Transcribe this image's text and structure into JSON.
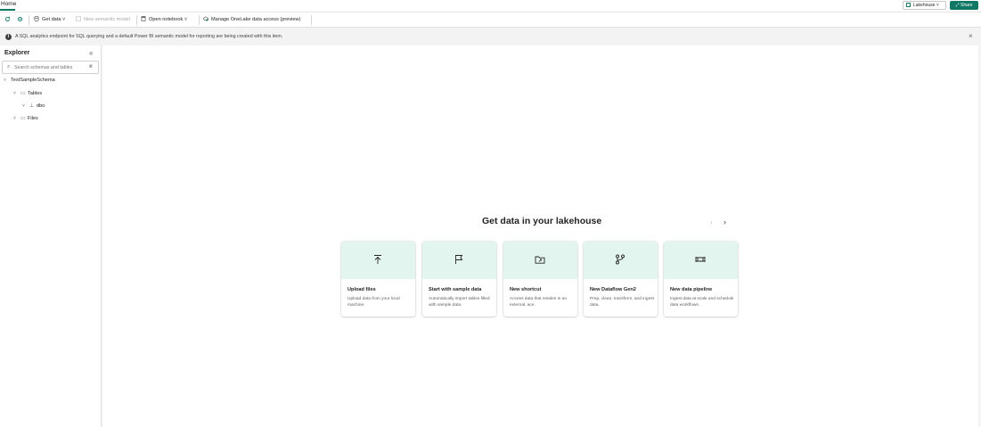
{
  "topbar": {
    "tab_home": "Home",
    "lakehouse_switch": "Lakehouse",
    "share": "Share"
  },
  "toolbar": {
    "get_data": "Get data",
    "new_semantic_model": "New semantic model",
    "open_notebook": "Open notebook",
    "manage_onelake": "Manage OneLake data access (preview)"
  },
  "banner": {
    "text": "A SQL analytics endpoint for SQL querying and a default Power BI semantic model for reporting are being created with this item."
  },
  "explorer": {
    "title": "Explorer",
    "search_placeholder": "Search schemas and tables",
    "tree": {
      "root": "TestSampleSchema",
      "tables": "Tables",
      "dbo": "dbo",
      "files": "Files"
    }
  },
  "main": {
    "title": "Get data in your lakehouse",
    "cards": [
      {
        "title": "Upload files",
        "desc": "Upload data from your local machine.",
        "icon": "upload-icon"
      },
      {
        "title": "Start with sample data",
        "desc": "Automatically import tables filled with sample data.",
        "icon": "flag-icon"
      },
      {
        "title": "New shortcut",
        "desc": "Access data that resides in an external, ace.",
        "icon": "folder-link-icon"
      },
      {
        "title": "New Dataflow Gen2",
        "desc": "Prep, clean, transform, and ingest data.",
        "icon": "dataflow-icon"
      },
      {
        "title": "New data pipeline",
        "desc": "Ingest data at scale and schedule data workflows.",
        "icon": "pipeline-icon"
      }
    ]
  },
  "colors": {
    "accent": "#117865",
    "card_hero": "#e3f5ef"
  }
}
